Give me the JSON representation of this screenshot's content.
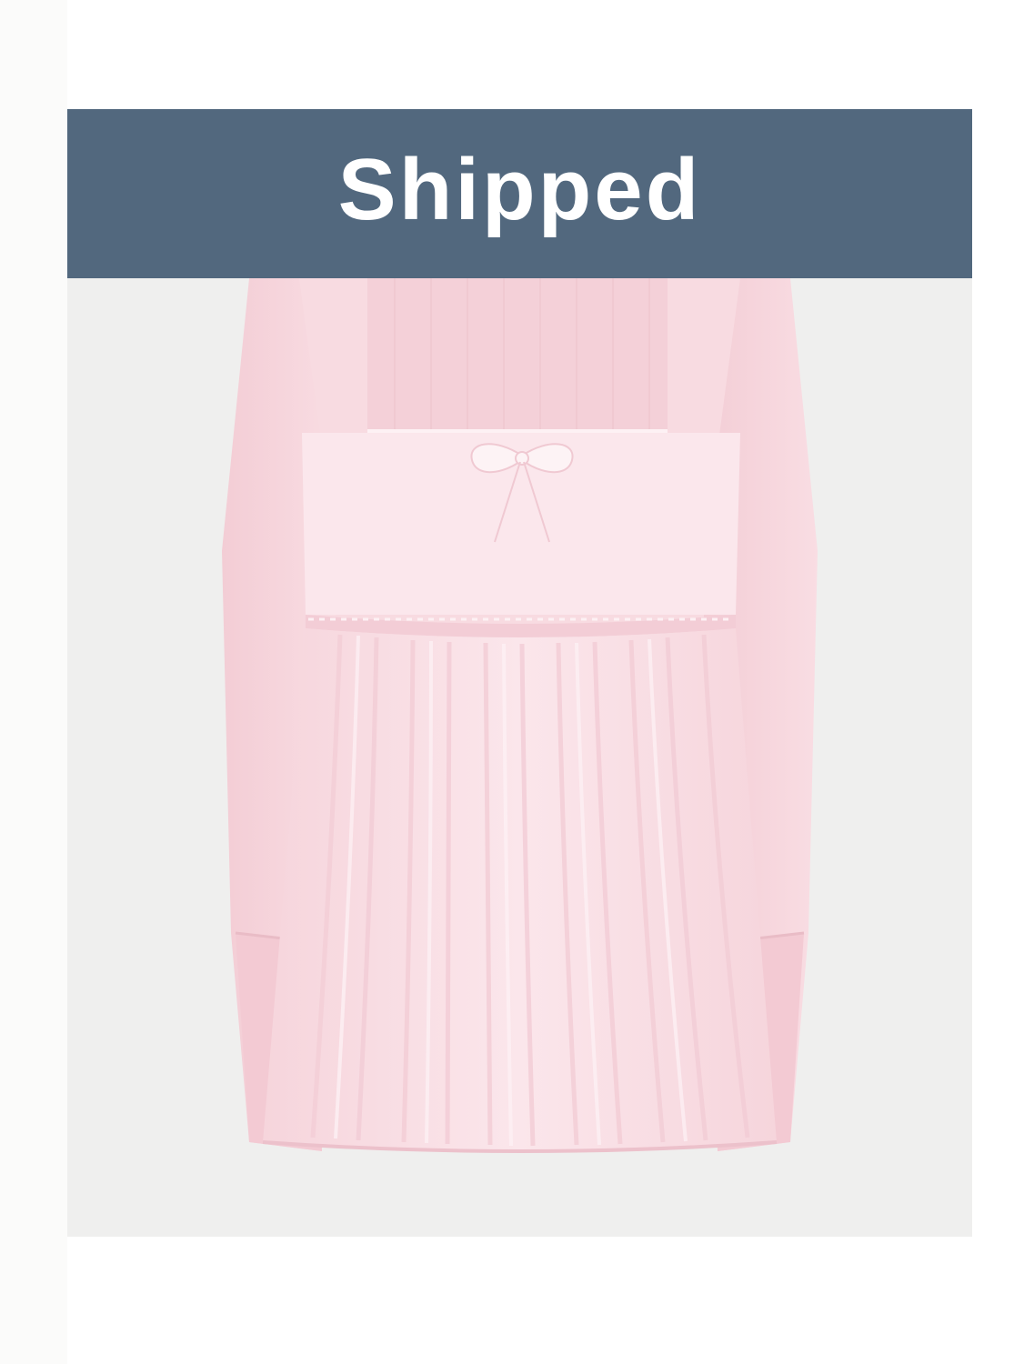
{
  "status_banner": {
    "label": "Shipped",
    "background_color": "#52687e",
    "text_color": "#ffffff"
  },
  "product_image": {
    "icon": "pink-babydoll-top-image",
    "background_color": "#efefee",
    "garment_color": "#f9dde3"
  }
}
